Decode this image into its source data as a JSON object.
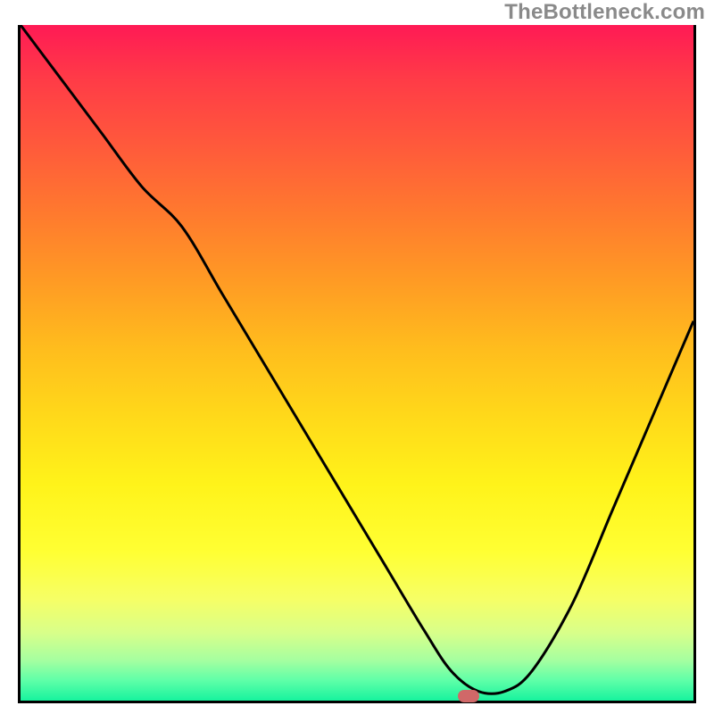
{
  "watermark": "TheBottleneck.com",
  "chart_data": {
    "type": "line",
    "title": "",
    "xlabel": "",
    "ylabel": "",
    "xlim": [
      0,
      100
    ],
    "ylim": [
      0,
      100
    ],
    "grid": false,
    "legend": false,
    "background": "rainbow-vertical-gradient (red→orange→yellow→green)",
    "series": [
      {
        "name": "bottleneck-curve",
        "color": "#000000",
        "x": [
          0,
          6,
          12,
          18,
          24,
          30,
          36,
          42,
          48,
          54,
          60,
          64,
          68,
          72,
          76,
          82,
          88,
          94,
          100
        ],
        "values": [
          100,
          92,
          84,
          76,
          70,
          60,
          50,
          40,
          30,
          20,
          10,
          4,
          1,
          1,
          4,
          14,
          28,
          42,
          56
        ]
      }
    ],
    "marker": {
      "x": 66,
      "y": 1,
      "color": "#d06868",
      "shape": "rounded-rect"
    }
  }
}
